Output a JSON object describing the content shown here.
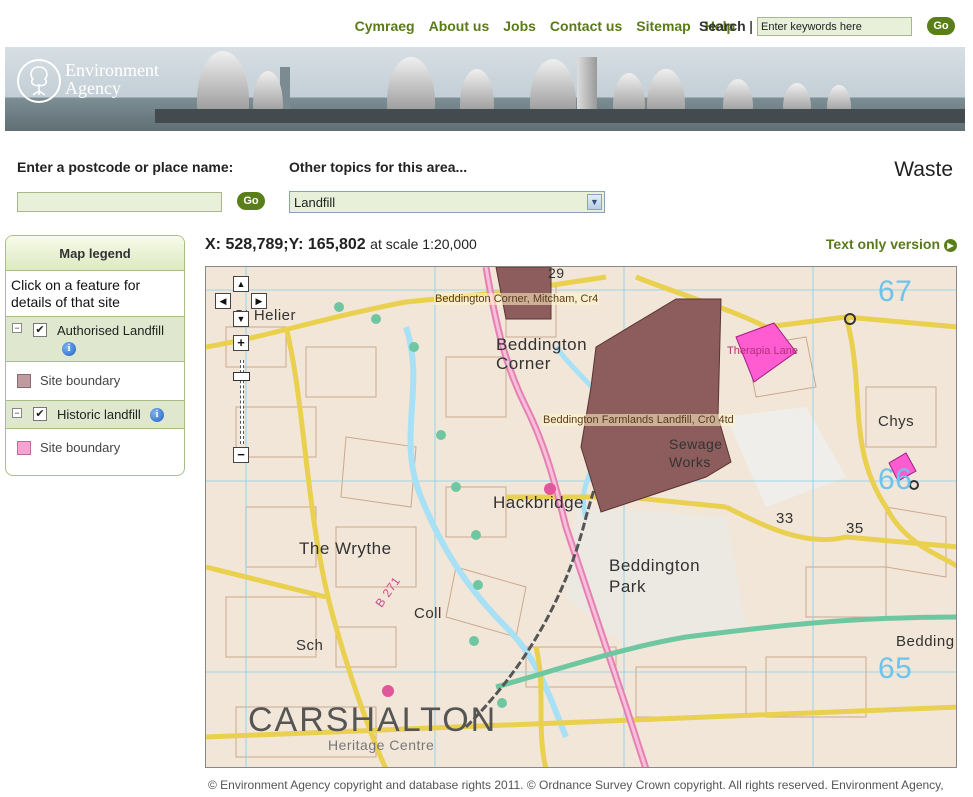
{
  "topnav": {
    "links": [
      "Cymraeg",
      "About us",
      "Jobs",
      "Contact us",
      "Sitemap",
      "Help"
    ],
    "separator": "|",
    "search_label": "Search",
    "search_placeholder": "Enter keywords here",
    "go_label": "Go"
  },
  "banner": {
    "logo_line1": "Environment",
    "logo_line2": "Agency"
  },
  "search": {
    "postcode_label": "Enter a postcode or place name:",
    "postcode_value": "",
    "go_label": "Go",
    "topics_label": "Other topics for this area...",
    "topics_selected": "Landfill"
  },
  "page_title": "Waste",
  "legend": {
    "title": "Map legend",
    "hint": "Click on a feature for details of that site",
    "groups": [
      {
        "label": "Authorised Landfill",
        "item": "Site boundary",
        "swatch_color": "#bf9a9e"
      },
      {
        "label": "Historic landfill",
        "item": "Site boundary",
        "swatch_color": "#f7a3d2"
      }
    ]
  },
  "coords": {
    "main": "X: 528,789;Y: 165,802",
    "scale": "at scale 1:20,000"
  },
  "text_only": "Text only version",
  "map": {
    "feature_labels": [
      "Beddington Corner, Mitcham, Cr4",
      "Beddington Farmlands Landfill, Cr0 4td",
      "Therapia Lane"
    ],
    "place_names": [
      "Beddington Corner",
      "Hackbridge",
      "The Wrythe",
      "Beddington Park",
      "CARSHALTON",
      "St Helier",
      "Sewage Works",
      "Chys",
      "Heritage Centre",
      "Sch",
      "Coll",
      "Bedding"
    ],
    "grid_numbers": [
      "29",
      "67",
      "66",
      "65",
      "33",
      "35"
    ],
    "road_label": "B 271",
    "zoom_in": "+",
    "zoom_out": "−",
    "authorised_color": "#8d5c5c",
    "historic_color": "#ff5cd2"
  },
  "footer": "© Environment Agency copyright and database rights 2011. © Ordnance Survey Crown copyright. All rights reserved. Environment Agency,"
}
